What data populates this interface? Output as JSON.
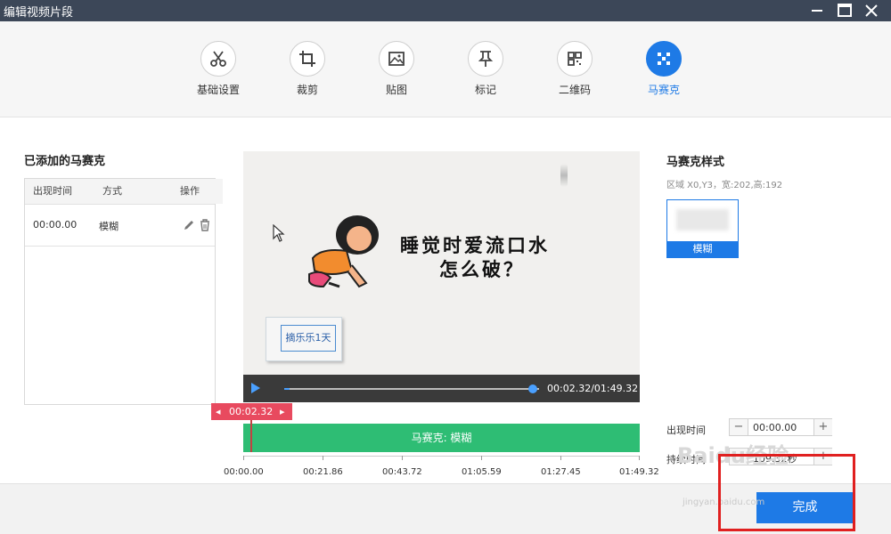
{
  "window": {
    "title": "编辑视频片段",
    "minimize_icon": "minimize-icon",
    "maximize_icon": "maximize-icon",
    "close_icon": "close-icon"
  },
  "toolbar": {
    "tools": [
      {
        "label": "基础设置",
        "icon": "scissors-icon"
      },
      {
        "label": "裁剪",
        "icon": "crop-icon"
      },
      {
        "label": "贴图",
        "icon": "image-icon"
      },
      {
        "label": "标记",
        "icon": "pin-icon"
      },
      {
        "label": "二维码",
        "icon": "qrcode-icon"
      },
      {
        "label": "马赛克",
        "icon": "mosaic-icon",
        "active": true
      }
    ],
    "accent": "#1e7ae6"
  },
  "left_panel": {
    "title": "已添加的马赛克",
    "columns": [
      "出现时间",
      "方式",
      "操作"
    ],
    "rows": [
      {
        "time": "00:00.00",
        "mode": "模糊",
        "actions": [
          "edit-icon",
          "trash-icon"
        ]
      }
    ]
  },
  "preview": {
    "caption_line1": "睡觉时爱流口水",
    "caption_line2": "怎么破？",
    "box_text": "摘乐乐1天",
    "time_display": "00:02.32/01:49.32",
    "progress": 0.02
  },
  "timeline": {
    "cursor_time": "00:02.32",
    "clip_label": "马赛克: 模糊",
    "ticks": [
      "00:00.00",
      "00:21.86",
      "00:43.72",
      "01:05.59",
      "01:27.45",
      "01:49.32"
    ],
    "clip_color": "#2ebd74"
  },
  "right_panel": {
    "title": "马赛克样式",
    "area_info": "区域 X0,Y3，宽:202,高:192",
    "style_label": "模糊",
    "appear_label": "出现时间",
    "appear_value": "00:00.00",
    "duration_label": "持续时间",
    "duration_value": "109.32秒"
  },
  "footer": {
    "done_label": "完成"
  },
  "watermark": {
    "text": "Baidu经验",
    "url": "jingyan.baidu.com"
  }
}
